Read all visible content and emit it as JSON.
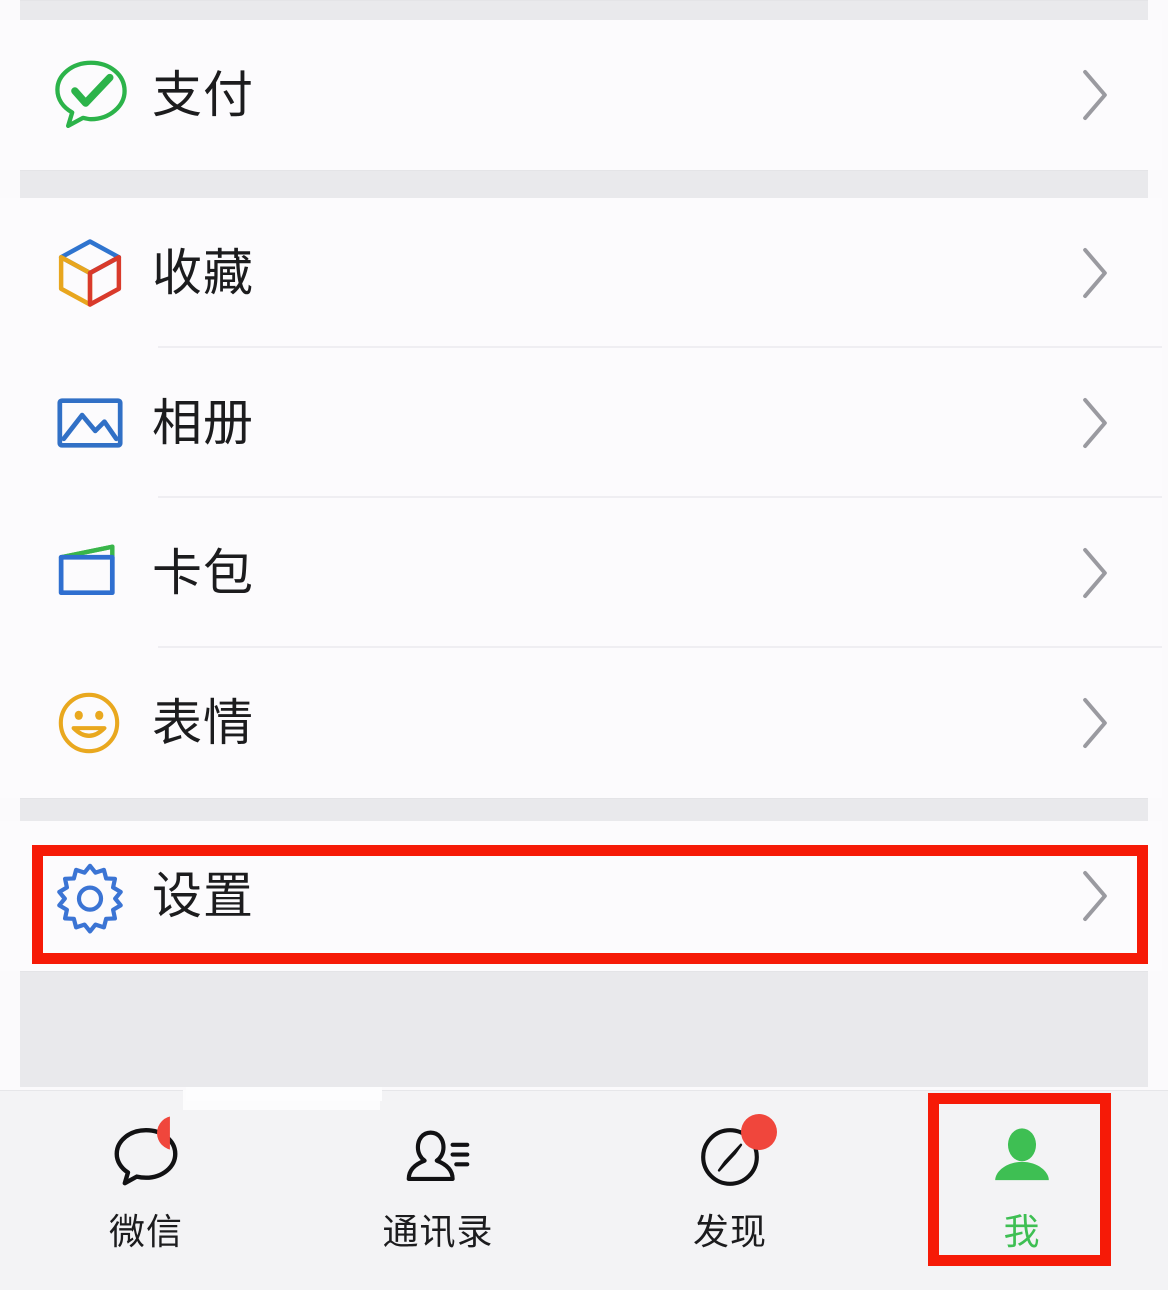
{
  "app": {
    "name": "WeChat",
    "screen_title": "Me"
  },
  "theme": {
    "page_background": "#fbfafc",
    "card_background": "#fcfbfd",
    "gap_band": "#e9e9ec",
    "divider": "#efeef2",
    "text_primary": "#1c1c1e",
    "chevron": "#9a9aa0",
    "accent_green": "#3ebf53",
    "annotation_red": "#f61a07",
    "badge_red": "#f0463c"
  },
  "sections": [
    {
      "name": "pay-section",
      "rows": [
        {
          "key": "pay",
          "label": "支付",
          "icon": "pay-icon",
          "icon_color": "#2cb34a",
          "chevron": "chevron-right-icon"
        }
      ]
    },
    {
      "name": "services-section",
      "rows": [
        {
          "key": "favorites",
          "label": "收藏",
          "icon": "favorites-cube-icon",
          "icon_color": "#3a7bd5",
          "chevron": "chevron-right-icon"
        },
        {
          "key": "album",
          "label": "相册",
          "icon": "album-photo-icon",
          "icon_color": "#3a7bd5",
          "chevron": "chevron-right-icon"
        },
        {
          "key": "cards",
          "label": "卡包",
          "icon": "cards-wallet-icon",
          "icon_color": "#2f6fd0",
          "chevron": "chevron-right-icon"
        },
        {
          "key": "stickers",
          "label": "表情",
          "icon": "stickers-smiley-icon",
          "icon_color": "#e9a81f",
          "chevron": "chevron-right-icon"
        }
      ]
    },
    {
      "name": "settings-section",
      "rows": [
        {
          "key": "settings",
          "label": "设置",
          "icon": "settings-gear-icon",
          "icon_color": "#3b74d4",
          "chevron": "chevron-right-icon"
        }
      ]
    }
  ],
  "tabbar": {
    "items": [
      {
        "key": "chats",
        "label": "微信",
        "icon": "chat-bubble-icon",
        "active": false,
        "badge": true
      },
      {
        "key": "contacts",
        "label": "通讯录",
        "icon": "contacts-icon",
        "active": false,
        "badge": false
      },
      {
        "key": "discover",
        "label": "发现",
        "icon": "compass-icon",
        "active": false,
        "badge": true
      },
      {
        "key": "me",
        "label": "我",
        "icon": "person-icon",
        "active": true,
        "badge": false
      }
    ]
  },
  "annotations": [
    {
      "name": "settings-row-highlight",
      "target": "设置",
      "color": "#f61a07"
    },
    {
      "name": "me-tab-highlight",
      "target": "我",
      "color": "#f61a07"
    }
  ]
}
